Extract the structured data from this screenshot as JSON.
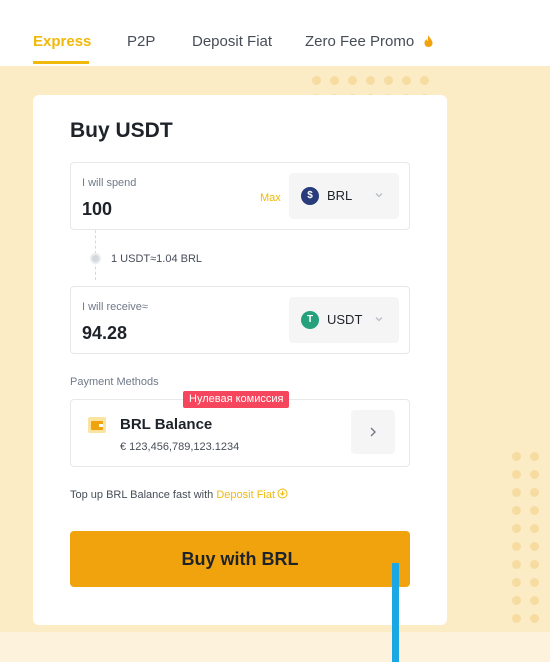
{
  "tabs": [
    {
      "label": "Express",
      "active": true
    },
    {
      "label": "P2P",
      "active": false
    },
    {
      "label": "Deposit Fiat",
      "active": false
    },
    {
      "label": "Zero Fee Promo",
      "active": false,
      "icon": "fire-icon"
    }
  ],
  "card": {
    "title": "Buy USDT",
    "spend": {
      "label": "I will spend",
      "value": "100",
      "max_label": "Max",
      "currency": "BRL",
      "currency_icon": "brl-coin-icon",
      "currency_icon_glyph": "$"
    },
    "rate": "1 USDT≈1.04 BRL",
    "receive": {
      "label": "I will receive≈",
      "value": "94.28",
      "currency": "USDT",
      "currency_icon": "usdt-coin-icon",
      "currency_icon_glyph": "T"
    },
    "payment": {
      "section_label": "Payment Methods",
      "promo_badge": "Нулевая комиссия",
      "method_name": "BRL Balance",
      "balance": "€ 123,456,789,123.1234",
      "icon": "wallet-icon"
    },
    "topup": {
      "text": "Top up BRL Balance fast with ",
      "link_label": "Deposit Fiat"
    },
    "buy_button_label": "Buy with BRL"
  },
  "colors": {
    "accent": "#f0b90b",
    "button": "#f0a30d",
    "background": "#fcecc6",
    "promo_red": "#f6465d",
    "usdt_green": "#26a17b",
    "brl_blue": "#283b7a"
  }
}
